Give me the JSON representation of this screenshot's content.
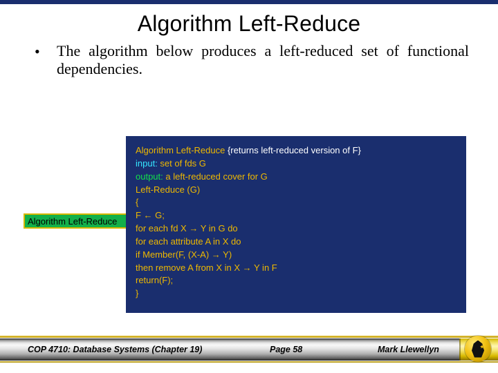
{
  "title": "Algorithm Left-Reduce",
  "bullet_dot": "•",
  "bullet": "The algorithm below produces a left-reduced set of functional dependencies.",
  "greenbox_label": "Algorithm Left-Reduce",
  "code": {
    "l1a": "Algorithm Left-Reduce",
    "l1b": "  {returns left-reduced version of F}",
    "l2a": "input:",
    "l2b": "  set of fds G",
    "l3a": "output:",
    "l3b": " a left-reduced cover for G",
    "l4": "Left-Reduce (G)",
    "l5": "{",
    "l6": "      F ← G;",
    "l7": "      for each fd X → Y in G do",
    "l8": "           for each attribute A in X do",
    "l9": "               if Member(F, (X-A) → Y)",
    "l10": "                   then remove A from X in X → Y in F",
    "l11": "      return(F);",
    "l12": "}"
  },
  "footer": {
    "left": "COP 4710: Database Systems  (Chapter 19)",
    "mid": "Page 58",
    "right": "Mark Llewellyn"
  }
}
